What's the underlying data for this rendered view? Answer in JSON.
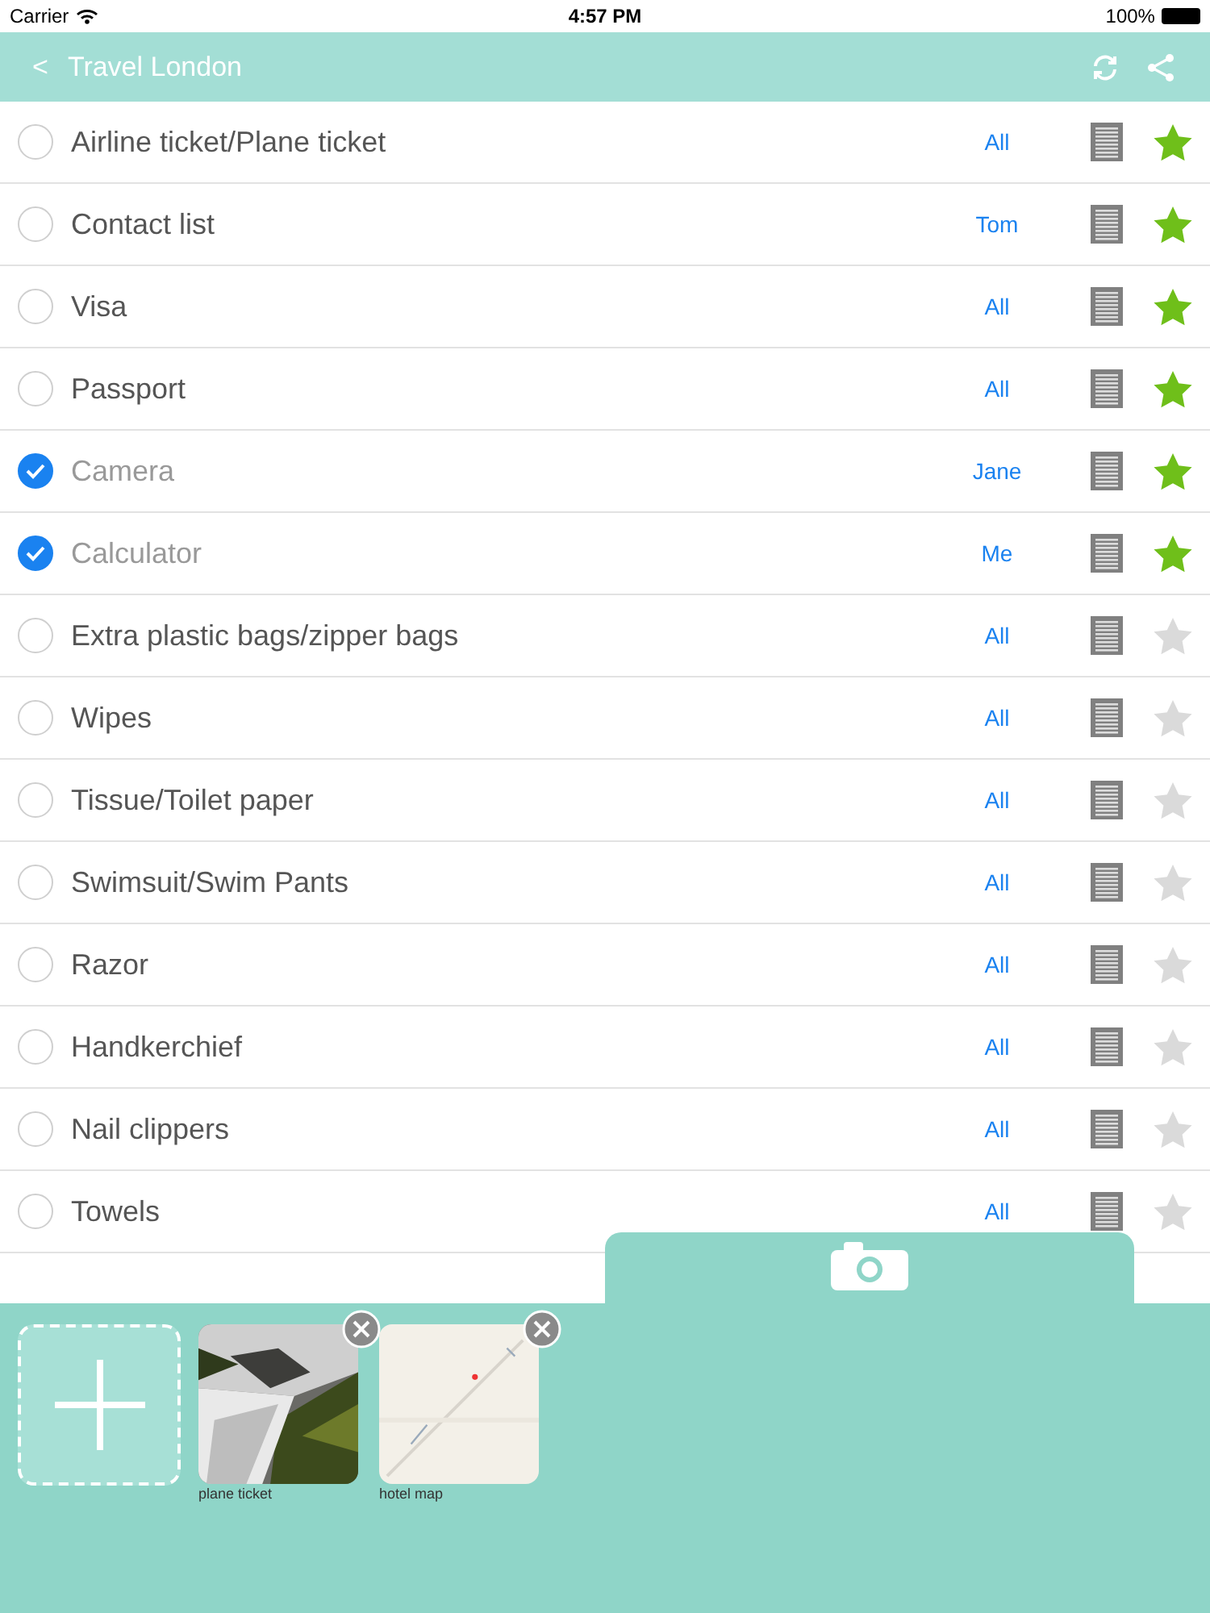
{
  "status_bar": {
    "carrier": "Carrier",
    "time": "4:57 PM",
    "battery": "100%"
  },
  "nav": {
    "back": "<",
    "title": "Travel London"
  },
  "items": [
    {
      "name": "Airline ticket/Plane ticket",
      "assignee": "All",
      "checked": false,
      "starred": true
    },
    {
      "name": "Contact list",
      "assignee": "Tom",
      "checked": false,
      "starred": true
    },
    {
      "name": "Visa",
      "assignee": "All",
      "checked": false,
      "starred": true
    },
    {
      "name": "Passport",
      "assignee": "All",
      "checked": false,
      "starred": true
    },
    {
      "name": "Camera",
      "assignee": "Jane",
      "checked": true,
      "starred": true
    },
    {
      "name": "Calculator",
      "assignee": "Me",
      "checked": true,
      "starred": true
    },
    {
      "name": "Extra plastic bags/zipper bags",
      "assignee": "All",
      "checked": false,
      "starred": false
    },
    {
      "name": "Wipes",
      "assignee": "All",
      "checked": false,
      "starred": false
    },
    {
      "name": "Tissue/Toilet paper",
      "assignee": "All",
      "checked": false,
      "starred": false
    },
    {
      "name": "Swimsuit/Swim Pants",
      "assignee": "All",
      "checked": false,
      "starred": false
    },
    {
      "name": "Razor",
      "assignee": "All",
      "checked": false,
      "starred": false
    },
    {
      "name": "Handkerchief",
      "assignee": "All",
      "checked": false,
      "starred": false
    },
    {
      "name": "Nail clippers",
      "assignee": "All",
      "checked": false,
      "starred": false
    },
    {
      "name": "Towels",
      "assignee": "All",
      "checked": false,
      "starred": false
    }
  ],
  "attachments": [
    {
      "label": "plane ticket"
    },
    {
      "label": "hotel map"
    }
  ]
}
